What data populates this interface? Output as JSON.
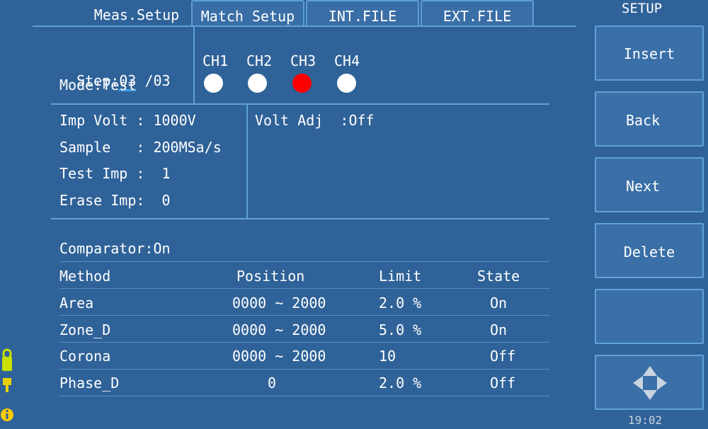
{
  "tabs": [
    {
      "label": "Meas.Setup",
      "active": true
    },
    {
      "label": "Match Setup",
      "active": false
    },
    {
      "label": "INT.FILE",
      "active": false
    },
    {
      "label": "EXT.FILE",
      "active": false
    }
  ],
  "sidebar": {
    "title": "SETUP",
    "buttons": [
      "Insert",
      "Back",
      "Next",
      "Delete",
      ""
    ],
    "clock": "19:02"
  },
  "step": {
    "label": "Step:",
    "current": "03",
    "total": " /03"
  },
  "mode": "Mode:Test",
  "channels": [
    {
      "label": "CH1",
      "color": "#ffffff"
    },
    {
      "label": "CH2",
      "color": "#ffffff"
    },
    {
      "label": "CH3",
      "color": "#ff0000"
    },
    {
      "label": "CH4",
      "color": "#ffffff"
    }
  ],
  "params": {
    "imp_volt": "Imp Volt : 1000V",
    "sample": "Sample   : 200MSa/s",
    "test_imp": "Test Imp :  1",
    "erase_imp": "Erase Imp:  0",
    "volt_adj": "Volt Adj  :Off"
  },
  "comparator": "Comparator:On",
  "table": {
    "headers": [
      "Method",
      "Position",
      "Limit",
      "State"
    ],
    "rows": [
      [
        "Area",
        "0000 ~ 2000",
        "2.0 %",
        "On"
      ],
      [
        "Zone_D",
        "0000 ~ 2000",
        "5.0 %",
        "On"
      ],
      [
        "Corona",
        "0000 ~ 2000",
        "10",
        "Off"
      ],
      [
        "Phase_D",
        "0",
        "2.0 %",
        "Off"
      ]
    ]
  },
  "colors": {
    "background": "#2f6298",
    "border": "#5fa2d8",
    "active_channel": "#ff0000",
    "highlight": "#4aa3e6"
  }
}
